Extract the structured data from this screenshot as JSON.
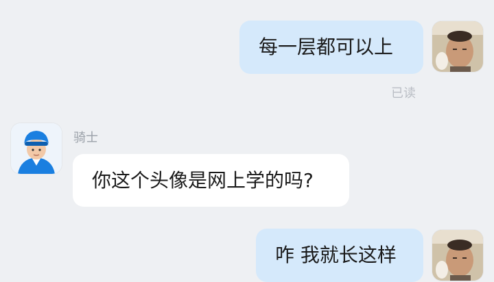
{
  "messages": [
    {
      "direction": "outgoing",
      "text": "每一层都可以上",
      "status": "已读"
    },
    {
      "direction": "incoming",
      "sender": "骑士",
      "text": "你这个头像是网上学的吗?"
    },
    {
      "direction": "outgoing",
      "text": "咋 我就长这样"
    }
  ],
  "colors": {
    "background": "#eef0f3",
    "outgoing_bubble": "#d5e9fb",
    "incoming_bubble": "#ffffff",
    "rider_avatar_blue": "#1a7fe0"
  },
  "icons": {
    "self_avatar": "user-photo-avatar",
    "rider_avatar": "delivery-rider-helmet-avatar"
  }
}
